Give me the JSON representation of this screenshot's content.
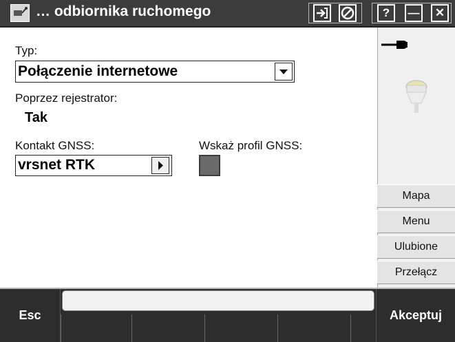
{
  "titlebar": {
    "title": "… odbiornika ruchomego",
    "app_icon": "antenna-icon",
    "buttons": [
      "login-arrow-icon",
      "no-entry-icon"
    ],
    "help_label": "?",
    "minimize_label": "—",
    "close_label": "✕"
  },
  "form": {
    "type_label": "Typ:",
    "type_value": "Połączenie internetowe",
    "via_logger_label": "Poprzez rejestrator:",
    "via_logger_value": "Tak",
    "gnss_contact_label": "Kontakt GNSS:",
    "gnss_contact_value": "vrsnet RTK",
    "show_profile_label": "Wskaż profil GNSS:",
    "show_profile_checked": true
  },
  "side_panel": {
    "power_icon": "power-plug-icon",
    "receiver_icon": "gnss-receiver-icon",
    "buttons": [
      {
        "label": "Mapa"
      },
      {
        "label": "Menu"
      },
      {
        "label": "Ulubione"
      },
      {
        "label": "Przełącz"
      }
    ]
  },
  "bottom": {
    "esc_label": "Esc",
    "accept_label": "Akceptuj"
  },
  "colors": {
    "titlebar_bg": "#3c3c3c",
    "bottom_bg": "#2d2d2d",
    "panel_bg": "#f0f0f0",
    "checkbox_fill": "#6a6a6a"
  }
}
